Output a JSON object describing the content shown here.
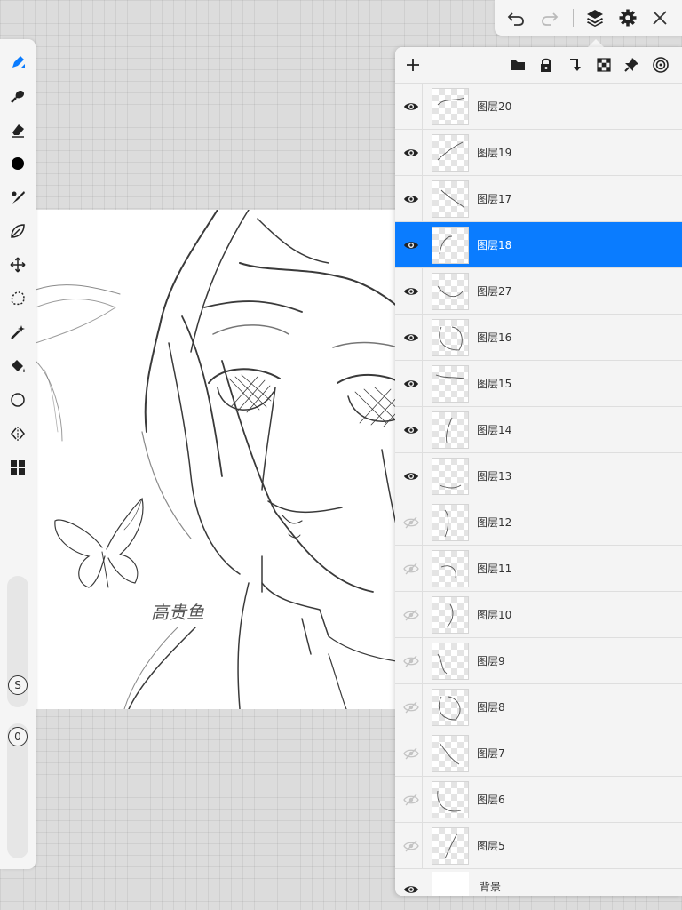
{
  "app": {
    "accent_color": "#0a7cff"
  },
  "topbar": {
    "buttons": [
      {
        "name": "undo-icon"
      },
      {
        "name": "redo-icon"
      },
      {
        "name": "layers-icon"
      },
      {
        "name": "gear-icon"
      },
      {
        "name": "close-icon"
      }
    ]
  },
  "toolbar": {
    "tools": [
      "brush-pen-icon",
      "smudge-icon",
      "eraser-icon",
      "color-dot-icon",
      "brush-icon",
      "leaf-icon",
      "move-icon",
      "lasso-icon",
      "magic-wand-icon",
      "fill-bucket-icon",
      "circle-shape-icon",
      "symmetry-icon",
      "grid-icon"
    ],
    "size_knob": "S",
    "opacity_knob": "0"
  },
  "canvas": {
    "signature": "高贵鱼"
  },
  "layers_panel": {
    "header_buttons": [
      "add-icon",
      "folder-icon",
      "lock-icon",
      "merge-down-icon",
      "transparency-icon",
      "pin-icon",
      "target-icon"
    ],
    "layers": [
      {
        "name": "图层20",
        "visible": true,
        "selected": false
      },
      {
        "name": "图层19",
        "visible": true,
        "selected": false
      },
      {
        "name": "图层17",
        "visible": true,
        "selected": false
      },
      {
        "name": "图层18",
        "visible": true,
        "selected": true
      },
      {
        "name": "图层27",
        "visible": true,
        "selected": false
      },
      {
        "name": "图层16",
        "visible": true,
        "selected": false
      },
      {
        "name": "图层15",
        "visible": true,
        "selected": false
      },
      {
        "name": "图层14",
        "visible": true,
        "selected": false
      },
      {
        "name": "图层13",
        "visible": true,
        "selected": false
      },
      {
        "name": "图层12",
        "visible": false,
        "selected": false
      },
      {
        "name": "图层11",
        "visible": false,
        "selected": false
      },
      {
        "name": "图层10",
        "visible": false,
        "selected": false
      },
      {
        "name": "图层9",
        "visible": false,
        "selected": false
      },
      {
        "name": "图层8",
        "visible": false,
        "selected": false
      },
      {
        "name": "图层7",
        "visible": false,
        "selected": false
      },
      {
        "name": "图层6",
        "visible": false,
        "selected": false
      },
      {
        "name": "图层5",
        "visible": false,
        "selected": false
      }
    ],
    "background_layer": {
      "name": "背景",
      "visible": true
    }
  }
}
